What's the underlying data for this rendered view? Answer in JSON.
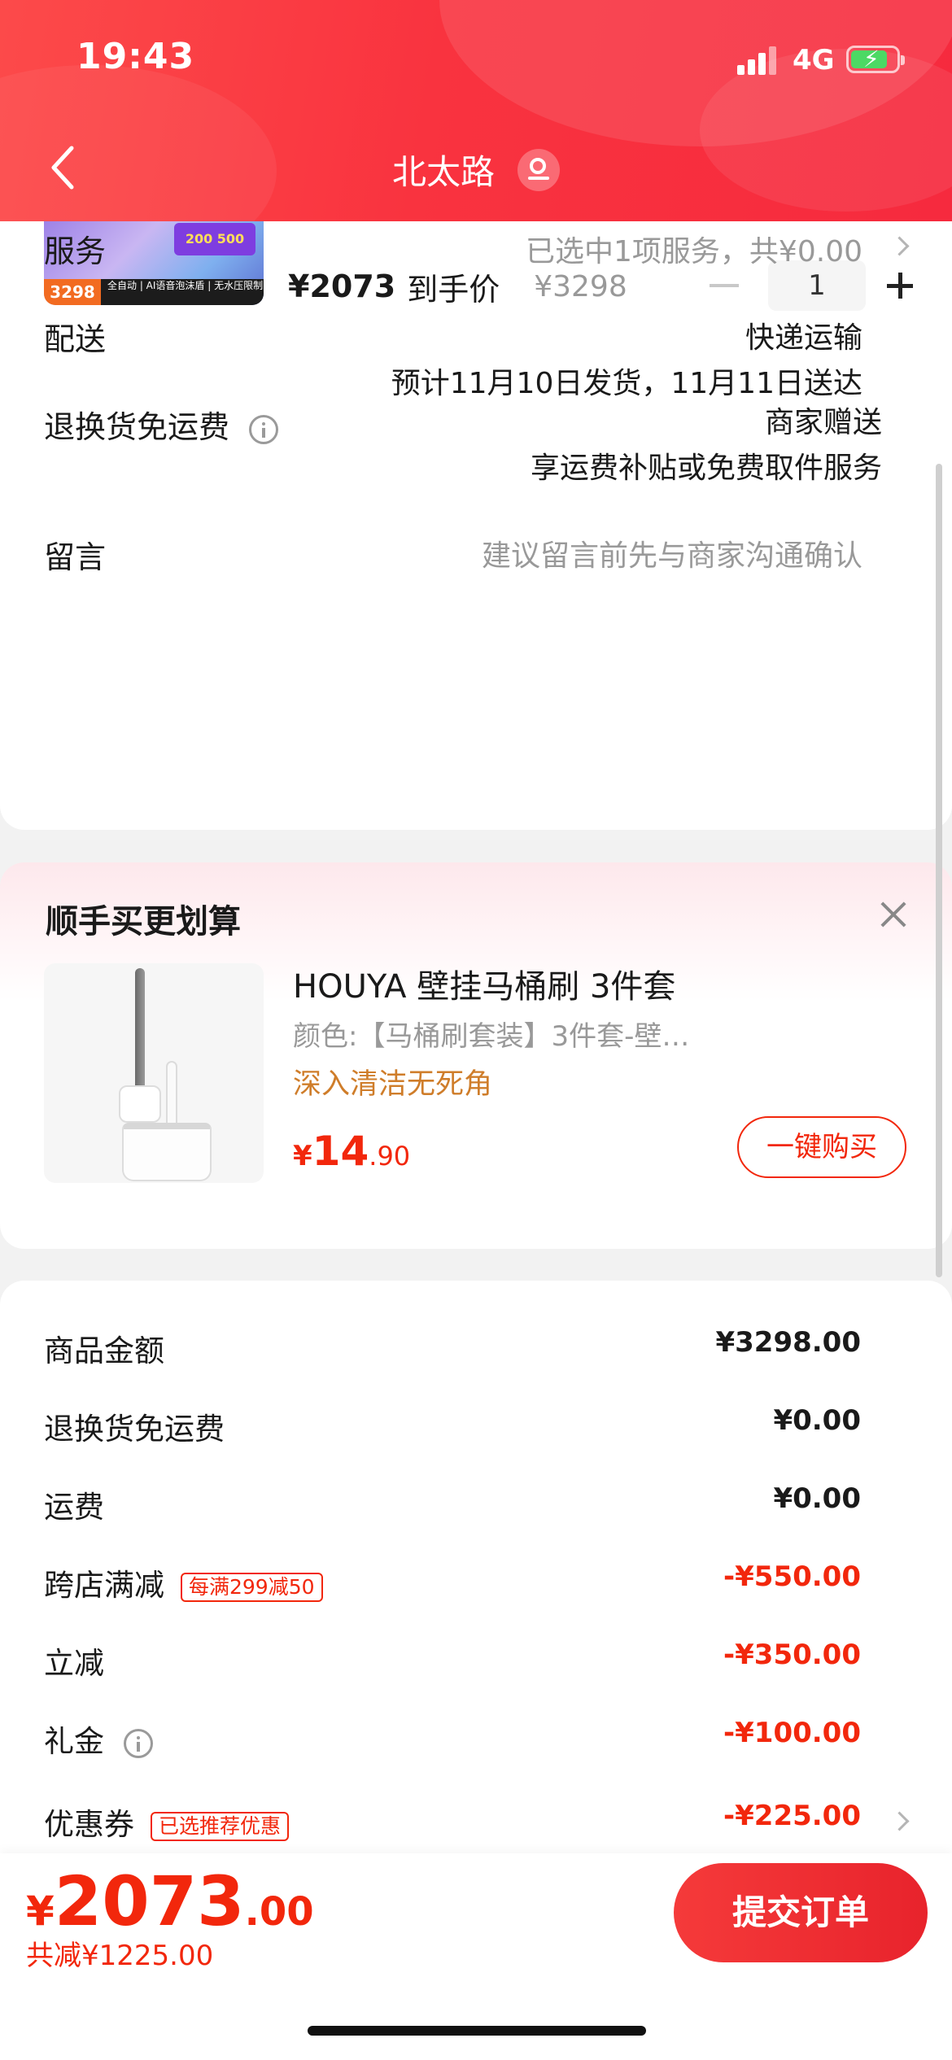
{
  "status_bar": {
    "time": "19:43",
    "network": "4G"
  },
  "nav": {
    "title": "北太路"
  },
  "product": {
    "thumb_price": "3298",
    "thumb_caption": "全自动 | AI语音泡沫盾 | 无水压限制",
    "thumb_promo": "200 500",
    "price": "¥2073",
    "price_suffix": "到手价",
    "original_price": "¥3298",
    "quantity": "1"
  },
  "order_rows": {
    "service_label": "服务",
    "service_value": "已选中1项服务，共¥0.00",
    "delivery_label": "配送",
    "delivery_method": "快递运输",
    "delivery_estimate": "预计11月10日发货，11月11日送达",
    "return_label": "退换货免运费",
    "return_value1": "商家赠送",
    "return_value2": "享运费补贴或免费取件服务",
    "message_label": "留言",
    "message_placeholder": "建议留言前先与商家沟通确认"
  },
  "recommend": {
    "title": "顺手买更划算",
    "name": "HOUYA 壁挂马桶刷 3件套",
    "spec": "颜色:【马桶刷套装】3件套-壁…",
    "slogan": "深入清洁无死角",
    "price_symbol": "¥",
    "price_int": "14",
    "price_dec": ".90",
    "buy_label": "一键购买"
  },
  "amounts": {
    "goods_label": "商品金额",
    "goods_value": "¥3298.00",
    "return_label": "退换货免运费",
    "return_value": "¥0.00",
    "shipping_label": "运费",
    "shipping_value": "¥0.00",
    "cross_label": "跨店满减",
    "cross_badge": "每满299减50",
    "cross_value": "-¥550.00",
    "instant_label": "立减",
    "instant_value": "-¥350.00",
    "gift_label": "礼金",
    "gift_value": "-¥100.00",
    "coupon_label": "优惠券",
    "coupon_badge": "已选推荐优惠",
    "coupon_value": "-¥225.00"
  },
  "checkout": {
    "symbol": "¥",
    "total_int": "2073",
    "total_dec": ".00",
    "saved": "共减¥1225.00",
    "submit_label": "提交订单"
  },
  "colors": {
    "accent": "#f2270c",
    "header": "#f9333f",
    "slogan": "#cf7d2a"
  }
}
